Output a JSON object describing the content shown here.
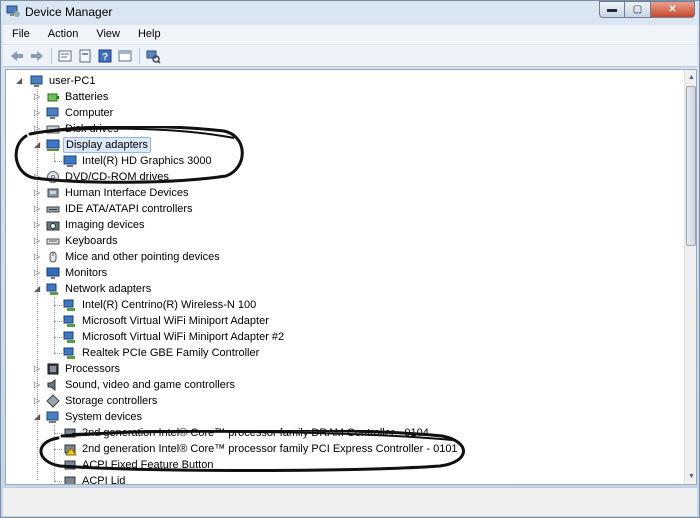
{
  "window": {
    "title": "Device Manager"
  },
  "menu": [
    "File",
    "Action",
    "View",
    "Help"
  ],
  "toolbar": [
    "back-icon",
    "forward-icon",
    "properties-icon",
    "update-driver-icon",
    "help-icon",
    "show-hide-icon",
    "scan-hardware-icon"
  ],
  "tree": {
    "root": "user-PC1",
    "items": [
      {
        "label": "Batteries",
        "icon": "battery-icon"
      },
      {
        "label": "Computer",
        "icon": "computer-icon"
      },
      {
        "label": "Disk drives",
        "icon": "disk-icon"
      },
      {
        "label": "Display adapters",
        "icon": "display-icon",
        "expanded": true,
        "selected": true,
        "children": [
          "Intel(R) HD Graphics 3000"
        ]
      },
      {
        "label": "DVD/CD-ROM drives",
        "icon": "dvd-icon"
      },
      {
        "label": "Human Interface Devices",
        "icon": "hid-icon"
      },
      {
        "label": "IDE ATA/ATAPI controllers",
        "icon": "ide-icon"
      },
      {
        "label": "Imaging devices",
        "icon": "camera-icon"
      },
      {
        "label": "Keyboards",
        "icon": "keyboard-icon"
      },
      {
        "label": "Mice and other pointing devices",
        "icon": "mouse-icon"
      },
      {
        "label": "Monitors",
        "icon": "monitor-icon"
      },
      {
        "label": "Network adapters",
        "icon": "network-icon",
        "expanded": true,
        "children": [
          "Intel(R) Centrino(R) Wireless-N 100",
          "Microsoft Virtual WiFi Miniport Adapter",
          "Microsoft Virtual WiFi Miniport Adapter #2",
          "Realtek PCIe GBE Family Controller"
        ]
      },
      {
        "label": "Processors",
        "icon": "processor-icon"
      },
      {
        "label": "Sound, video and game controllers",
        "icon": "sound-icon"
      },
      {
        "label": "Storage controllers",
        "icon": "storage-icon"
      },
      {
        "label": "System devices",
        "icon": "system-icon",
        "expanded": true,
        "children": [
          "2nd generation Intel® Core™ processor family DRAM Controller - 0104",
          "2nd generation Intel® Core™ processor family PCI Express Controller - 0101",
          "ACPI Fixed Feature Button",
          "ACPI Lid"
        ]
      }
    ]
  },
  "colors": {
    "selection": "#dbe8f8",
    "marker": "#111111"
  }
}
